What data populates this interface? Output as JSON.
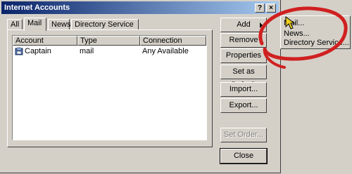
{
  "window": {
    "title": "Internet Accounts",
    "help_label": "?",
    "close_label": "×"
  },
  "tabs": [
    {
      "label": "All"
    },
    {
      "label": "Mail"
    },
    {
      "label": "News"
    },
    {
      "label": "Directory Service"
    }
  ],
  "list": {
    "columns": [
      "Account",
      "Type",
      "Connection"
    ],
    "rows": [
      {
        "account": "Captain",
        "type": "mail",
        "connection": "Any Available"
      }
    ]
  },
  "buttons": {
    "add": "Add",
    "remove": "Remove",
    "properties": "Properties",
    "set_default": "Set as Default",
    "import": "Import...",
    "export": "Export...",
    "set_order": "Set Order...",
    "close": "Close"
  },
  "add_menu": {
    "items": [
      "Mail...",
      "News...",
      "Directory Service..."
    ]
  },
  "colors": {
    "face": "#d4d0c8",
    "titlebar_start": "#0a246a",
    "titlebar_end": "#a6caf0",
    "highlight_circle": "#d02020"
  },
  "icons": {
    "account": "mail-account-icon",
    "cursor": "pointer-cursor-icon"
  }
}
